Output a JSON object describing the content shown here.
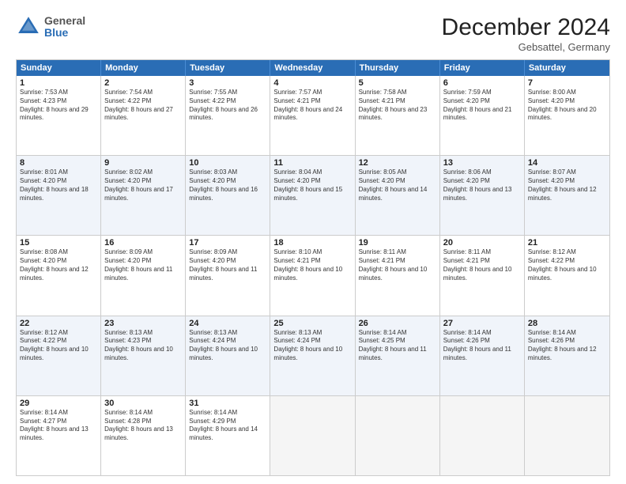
{
  "header": {
    "logo_general": "General",
    "logo_blue": "Blue",
    "month_title": "December 2024",
    "location": "Gebsattel, Germany"
  },
  "weekdays": [
    "Sunday",
    "Monday",
    "Tuesday",
    "Wednesday",
    "Thursday",
    "Friday",
    "Saturday"
  ],
  "rows": [
    [
      {
        "day": "1",
        "sunrise": "Sunrise: 7:53 AM",
        "sunset": "Sunset: 4:23 PM",
        "daylight": "Daylight: 8 hours and 29 minutes."
      },
      {
        "day": "2",
        "sunrise": "Sunrise: 7:54 AM",
        "sunset": "Sunset: 4:22 PM",
        "daylight": "Daylight: 8 hours and 27 minutes."
      },
      {
        "day": "3",
        "sunrise": "Sunrise: 7:55 AM",
        "sunset": "Sunset: 4:22 PM",
        "daylight": "Daylight: 8 hours and 26 minutes."
      },
      {
        "day": "4",
        "sunrise": "Sunrise: 7:57 AM",
        "sunset": "Sunset: 4:21 PM",
        "daylight": "Daylight: 8 hours and 24 minutes."
      },
      {
        "day": "5",
        "sunrise": "Sunrise: 7:58 AM",
        "sunset": "Sunset: 4:21 PM",
        "daylight": "Daylight: 8 hours and 23 minutes."
      },
      {
        "day": "6",
        "sunrise": "Sunrise: 7:59 AM",
        "sunset": "Sunset: 4:20 PM",
        "daylight": "Daylight: 8 hours and 21 minutes."
      },
      {
        "day": "7",
        "sunrise": "Sunrise: 8:00 AM",
        "sunset": "Sunset: 4:20 PM",
        "daylight": "Daylight: 8 hours and 20 minutes."
      }
    ],
    [
      {
        "day": "8",
        "sunrise": "Sunrise: 8:01 AM",
        "sunset": "Sunset: 4:20 PM",
        "daylight": "Daylight: 8 hours and 18 minutes."
      },
      {
        "day": "9",
        "sunrise": "Sunrise: 8:02 AM",
        "sunset": "Sunset: 4:20 PM",
        "daylight": "Daylight: 8 hours and 17 minutes."
      },
      {
        "day": "10",
        "sunrise": "Sunrise: 8:03 AM",
        "sunset": "Sunset: 4:20 PM",
        "daylight": "Daylight: 8 hours and 16 minutes."
      },
      {
        "day": "11",
        "sunrise": "Sunrise: 8:04 AM",
        "sunset": "Sunset: 4:20 PM",
        "daylight": "Daylight: 8 hours and 15 minutes."
      },
      {
        "day": "12",
        "sunrise": "Sunrise: 8:05 AM",
        "sunset": "Sunset: 4:20 PM",
        "daylight": "Daylight: 8 hours and 14 minutes."
      },
      {
        "day": "13",
        "sunrise": "Sunrise: 8:06 AM",
        "sunset": "Sunset: 4:20 PM",
        "daylight": "Daylight: 8 hours and 13 minutes."
      },
      {
        "day": "14",
        "sunrise": "Sunrise: 8:07 AM",
        "sunset": "Sunset: 4:20 PM",
        "daylight": "Daylight: 8 hours and 12 minutes."
      }
    ],
    [
      {
        "day": "15",
        "sunrise": "Sunrise: 8:08 AM",
        "sunset": "Sunset: 4:20 PM",
        "daylight": "Daylight: 8 hours and 12 minutes."
      },
      {
        "day": "16",
        "sunrise": "Sunrise: 8:09 AM",
        "sunset": "Sunset: 4:20 PM",
        "daylight": "Daylight: 8 hours and 11 minutes."
      },
      {
        "day": "17",
        "sunrise": "Sunrise: 8:09 AM",
        "sunset": "Sunset: 4:20 PM",
        "daylight": "Daylight: 8 hours and 11 minutes."
      },
      {
        "day": "18",
        "sunrise": "Sunrise: 8:10 AM",
        "sunset": "Sunset: 4:21 PM",
        "daylight": "Daylight: 8 hours and 10 minutes."
      },
      {
        "day": "19",
        "sunrise": "Sunrise: 8:11 AM",
        "sunset": "Sunset: 4:21 PM",
        "daylight": "Daylight: 8 hours and 10 minutes."
      },
      {
        "day": "20",
        "sunrise": "Sunrise: 8:11 AM",
        "sunset": "Sunset: 4:21 PM",
        "daylight": "Daylight: 8 hours and 10 minutes."
      },
      {
        "day": "21",
        "sunrise": "Sunrise: 8:12 AM",
        "sunset": "Sunset: 4:22 PM",
        "daylight": "Daylight: 8 hours and 10 minutes."
      }
    ],
    [
      {
        "day": "22",
        "sunrise": "Sunrise: 8:12 AM",
        "sunset": "Sunset: 4:22 PM",
        "daylight": "Daylight: 8 hours and 10 minutes."
      },
      {
        "day": "23",
        "sunrise": "Sunrise: 8:13 AM",
        "sunset": "Sunset: 4:23 PM",
        "daylight": "Daylight: 8 hours and 10 minutes."
      },
      {
        "day": "24",
        "sunrise": "Sunrise: 8:13 AM",
        "sunset": "Sunset: 4:24 PM",
        "daylight": "Daylight: 8 hours and 10 minutes."
      },
      {
        "day": "25",
        "sunrise": "Sunrise: 8:13 AM",
        "sunset": "Sunset: 4:24 PM",
        "daylight": "Daylight: 8 hours and 10 minutes."
      },
      {
        "day": "26",
        "sunrise": "Sunrise: 8:14 AM",
        "sunset": "Sunset: 4:25 PM",
        "daylight": "Daylight: 8 hours and 11 minutes."
      },
      {
        "day": "27",
        "sunrise": "Sunrise: 8:14 AM",
        "sunset": "Sunset: 4:26 PM",
        "daylight": "Daylight: 8 hours and 11 minutes."
      },
      {
        "day": "28",
        "sunrise": "Sunrise: 8:14 AM",
        "sunset": "Sunset: 4:26 PM",
        "daylight": "Daylight: 8 hours and 12 minutes."
      }
    ],
    [
      {
        "day": "29",
        "sunrise": "Sunrise: 8:14 AM",
        "sunset": "Sunset: 4:27 PM",
        "daylight": "Daylight: 8 hours and 13 minutes."
      },
      {
        "day": "30",
        "sunrise": "Sunrise: 8:14 AM",
        "sunset": "Sunset: 4:28 PM",
        "daylight": "Daylight: 8 hours and 13 minutes."
      },
      {
        "day": "31",
        "sunrise": "Sunrise: 8:14 AM",
        "sunset": "Sunset: 4:29 PM",
        "daylight": "Daylight: 8 hours and 14 minutes."
      },
      null,
      null,
      null,
      null
    ]
  ],
  "alt_rows": [
    1,
    3
  ]
}
